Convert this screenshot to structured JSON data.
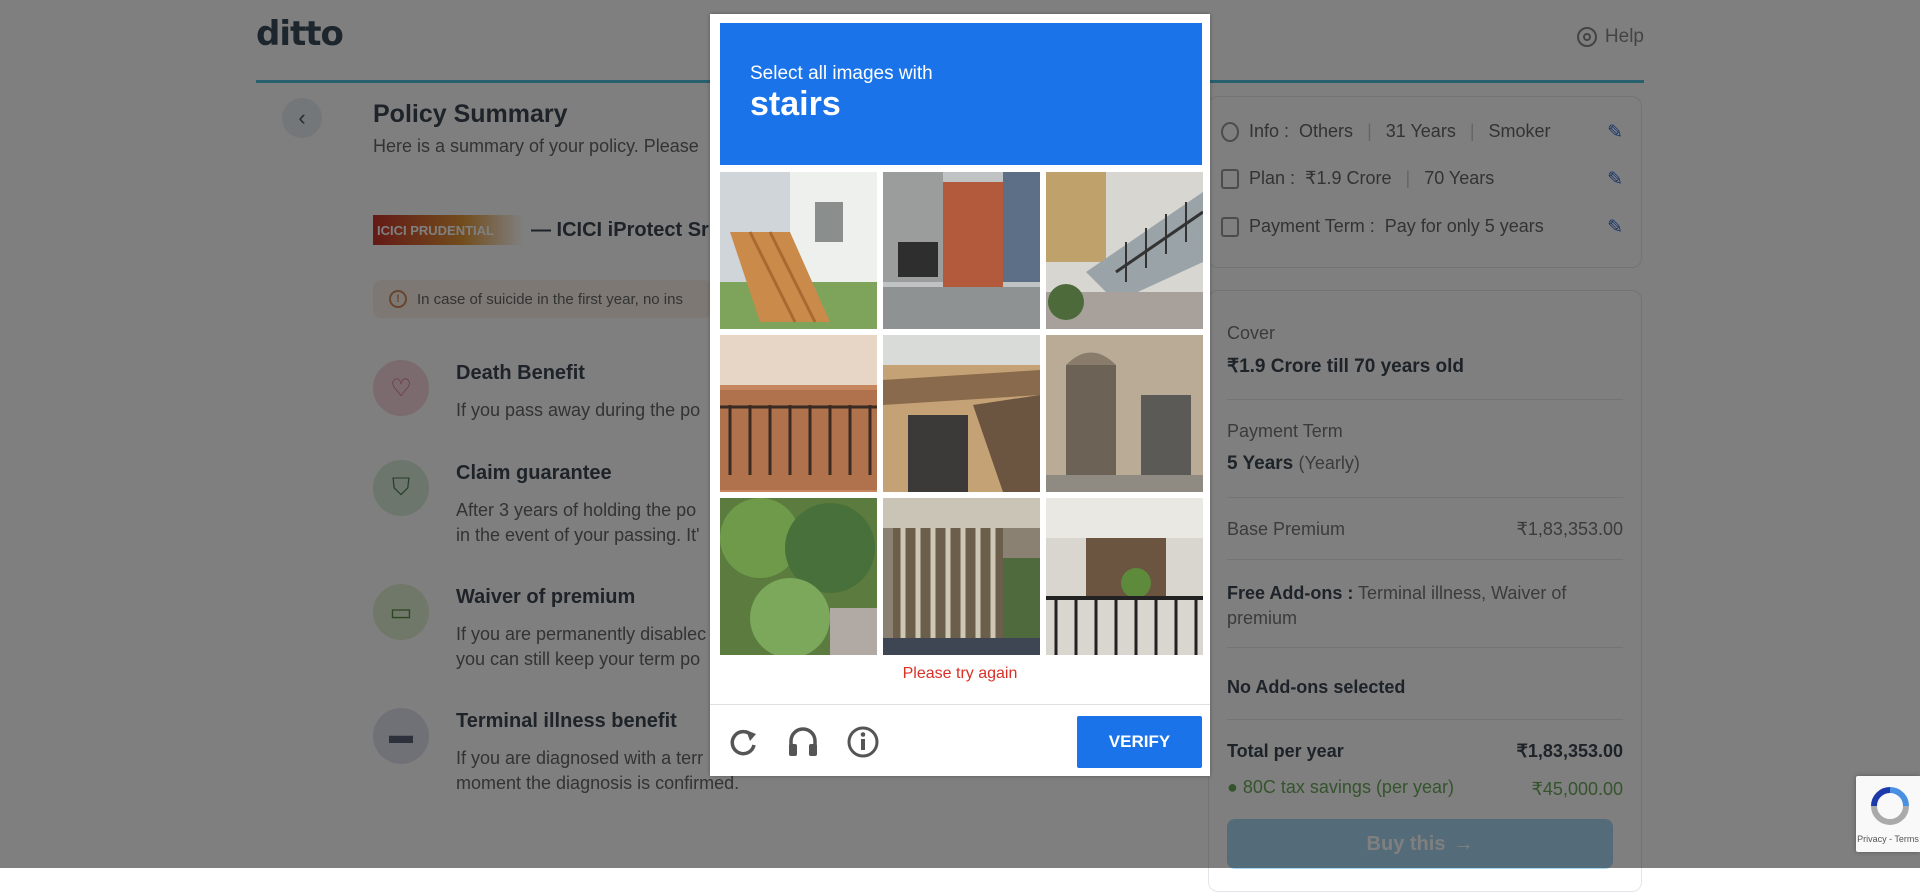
{
  "header": {
    "logo": "ditto",
    "help_label": "Help"
  },
  "summary": {
    "title": "Policy Summary",
    "subtitle": "Here is a summary of your policy. Please",
    "insurer_logo_text": "ICICI PRUDENTIAL",
    "insurer_name": "— ICICI iProtect Sr",
    "notice": "In case of suicide in the first year, no ins"
  },
  "benefits": [
    {
      "title": "Death Benefit",
      "desc": [
        "If you pass away during the po"
      ],
      "icon": "heart-icon",
      "color": "#f7d7de"
    },
    {
      "title": "Claim guarantee",
      "desc": [
        "After 3 years of holding the po",
        "in the event of your passing. It'"
      ],
      "icon": "shield-icon",
      "color": "#d9ecd9"
    },
    {
      "title": "Waiver of premium",
      "desc": [
        "If you are permanently disablec",
        "you can still keep your term po"
      ],
      "icon": "wallet-icon",
      "color": "#dff0d2"
    },
    {
      "title": "Terminal illness benefit",
      "desc": [
        "If you are diagnosed with a terr",
        "moment the diagnosis is confirmed."
      ],
      "icon": "bed-icon",
      "color": "#dfe2ee"
    }
  ],
  "info_card": {
    "rows": [
      {
        "label": "Info :",
        "values": [
          "Others",
          "31 Years",
          "Smoker"
        ]
      },
      {
        "label": "Plan :",
        "values": [
          "₹1.9 Crore",
          "70 Years"
        ]
      },
      {
        "label": "Payment Term :",
        "values": [
          "Pay for only 5 years"
        ]
      }
    ]
  },
  "price_card": {
    "cover_label": "Cover",
    "cover_value": "₹1.9 Crore till 70 years old",
    "term_label": "Payment Term",
    "term_value": "5 Years",
    "term_suffix": "(Yearly)",
    "base_label": "Base Premium",
    "base_value": "₹1,83,353.00",
    "free_addons_label": "Free Add-ons :",
    "free_addons_value_1": "Terminal illness, Waiver of",
    "free_addons_value_2": "premium",
    "no_addons": "No Add-ons selected",
    "total_label": "Total per year",
    "total_value": "₹1,83,353.00",
    "tax_label": "80C tax savings (per year)",
    "tax_value": "₹45,000.00",
    "buy_label": "Buy this"
  },
  "captcha": {
    "instruction": "Select all images with",
    "keyword": "stairs",
    "tiles": [
      "house-with-wooden-stairs",
      "street-garage-building",
      "outdoor-stairs-railing",
      "brick-wall-balcony",
      "building-window-balcony",
      "stone-building-door",
      "green-trees",
      "wooden-porch-stairs",
      "apartment-balcony-plants"
    ],
    "error": "Please try again",
    "verify_label": "VERIFY"
  },
  "badge": {
    "text": "Privacy - Terms"
  }
}
